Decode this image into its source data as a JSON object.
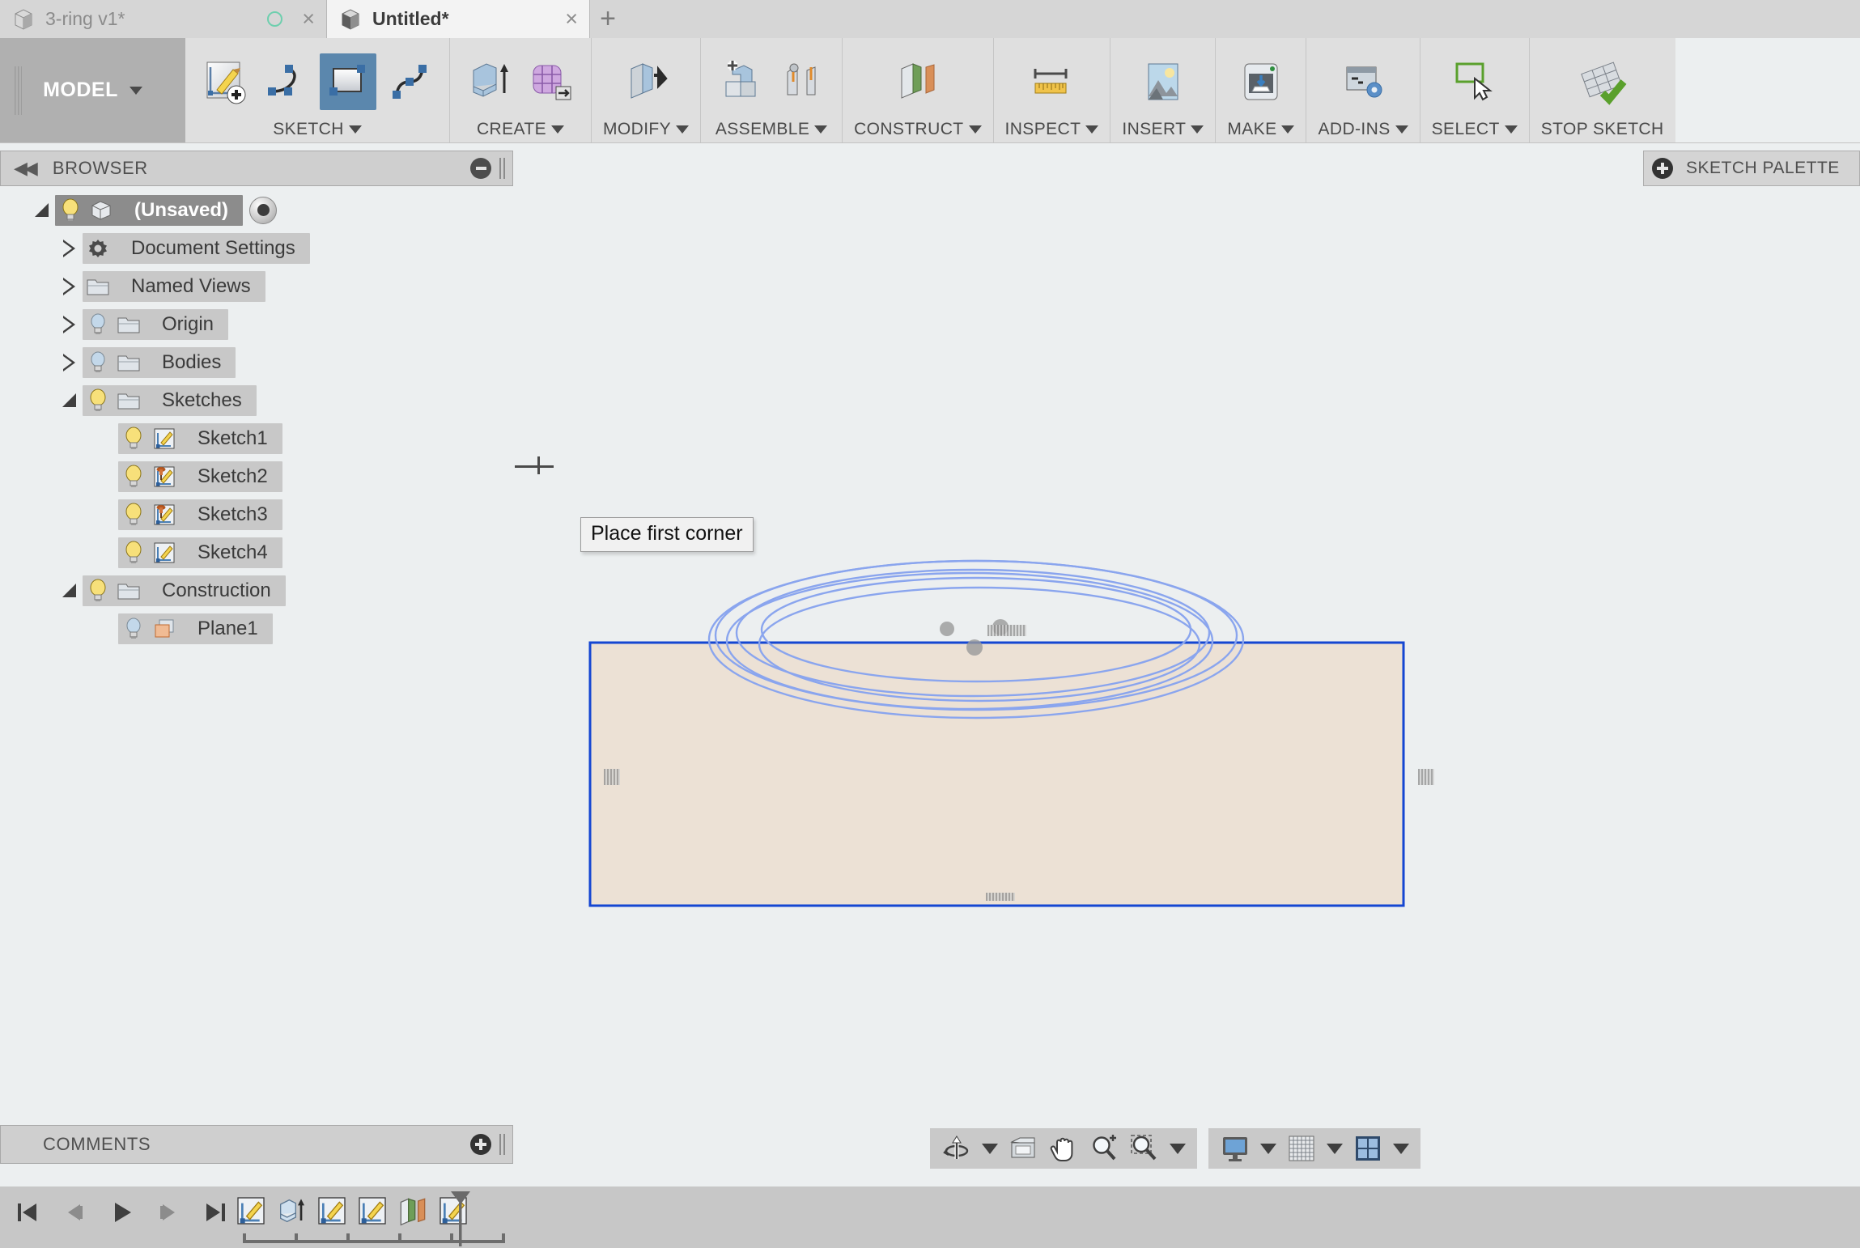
{
  "window": {
    "tabs": [
      {
        "label": "3-ring v1*",
        "active": false,
        "icon": "cube-icon",
        "has_status_circle": true,
        "close": "×"
      },
      {
        "label": "Untitled*",
        "active": true,
        "icon": "cube-icon",
        "has_status_circle": false,
        "close": "×"
      }
    ],
    "new_tab_label": "+"
  },
  "ribbon": {
    "workspace": {
      "label": "MODEL",
      "caret": "▼"
    },
    "groups": [
      {
        "name": "sketch",
        "label": "SKETCH",
        "caret": "▼",
        "tools": [
          {
            "name": "create-sketch-icon",
            "selected": false
          },
          {
            "name": "line-icon",
            "selected": false
          },
          {
            "name": "rectangle-icon",
            "selected": true
          },
          {
            "name": "spline-icon",
            "selected": false
          }
        ]
      },
      {
        "name": "create",
        "label": "CREATE",
        "caret": "▼",
        "tools": [
          {
            "name": "extrude-icon",
            "selected": false
          },
          {
            "name": "form-icon",
            "selected": false
          }
        ]
      },
      {
        "name": "modify",
        "label": "MODIFY",
        "caret": "▼",
        "tools": [
          {
            "name": "press-pull-icon",
            "selected": false
          }
        ]
      },
      {
        "name": "assemble",
        "label": "ASSEMBLE",
        "caret": "▼",
        "tools": [
          {
            "name": "new-component-icon",
            "selected": false
          },
          {
            "name": "joint-icon",
            "selected": false
          }
        ]
      },
      {
        "name": "construct",
        "label": "CONSTRUCT",
        "caret": "▼",
        "tools": [
          {
            "name": "offset-plane-icon",
            "selected": false
          }
        ]
      },
      {
        "name": "inspect",
        "label": "INSPECT",
        "caret": "▼",
        "tools": [
          {
            "name": "measure-icon",
            "selected": false
          }
        ]
      },
      {
        "name": "insert",
        "label": "INSERT",
        "caret": "▼",
        "tools": [
          {
            "name": "insert-image-icon",
            "selected": false
          }
        ]
      },
      {
        "name": "make",
        "label": "MAKE",
        "caret": "▼",
        "tools": [
          {
            "name": "3d-print-icon",
            "selected": false
          }
        ]
      },
      {
        "name": "add-ins",
        "label": "ADD-INS",
        "caret": "▼",
        "tools": [
          {
            "name": "scripts-addins-icon",
            "selected": false
          }
        ]
      },
      {
        "name": "select",
        "label": "SELECT",
        "caret": "▼",
        "tools": [
          {
            "name": "select-window-icon",
            "selected": false
          }
        ]
      },
      {
        "name": "stop-sketch",
        "label": "STOP SKETCH",
        "caret": "",
        "tools": [
          {
            "name": "stop-sketch-icon",
            "selected": false
          }
        ]
      }
    ]
  },
  "browser": {
    "title": "BROWSER",
    "collapse_arrow": "◀◀",
    "collapse_button": "minus-circle-icon",
    "tree": [
      {
        "label": "(Unsaved)",
        "depth": 0,
        "expander": "down",
        "bulb": "on",
        "icon": "component-cube-icon",
        "selected": true,
        "radio": true
      },
      {
        "label": "Document Settings",
        "depth": 1,
        "expander": "right",
        "bulb": "none",
        "icon": "gear-icon",
        "selected": false,
        "radio": false
      },
      {
        "label": "Named Views",
        "depth": 1,
        "expander": "right",
        "bulb": "none",
        "icon": "folder-icon",
        "selected": false,
        "radio": false
      },
      {
        "label": "Origin",
        "depth": 1,
        "expander": "right",
        "bulb": "off",
        "icon": "folder-icon",
        "selected": false,
        "radio": false
      },
      {
        "label": "Bodies",
        "depth": 1,
        "expander": "right",
        "bulb": "off",
        "icon": "folder-icon",
        "selected": false,
        "radio": false
      },
      {
        "label": "Sketches",
        "depth": 1,
        "expander": "down",
        "bulb": "on",
        "icon": "folder-icon",
        "selected": false,
        "radio": false
      },
      {
        "label": "Sketch1",
        "depth": 2,
        "expander": "none",
        "bulb": "on",
        "icon": "sketch-icon",
        "selected": false,
        "radio": false
      },
      {
        "label": "Sketch2",
        "depth": 2,
        "expander": "none",
        "bulb": "on",
        "icon": "sketch-pinned-icon",
        "selected": false,
        "radio": false
      },
      {
        "label": "Sketch3",
        "depth": 2,
        "expander": "none",
        "bulb": "on",
        "icon": "sketch-pinned-icon",
        "selected": false,
        "radio": false
      },
      {
        "label": "Sketch4",
        "depth": 2,
        "expander": "none",
        "bulb": "on",
        "icon": "sketch-icon",
        "selected": false,
        "radio": false
      },
      {
        "label": "Construction",
        "depth": 1,
        "expander": "down",
        "bulb": "on",
        "icon": "folder-icon",
        "selected": false,
        "radio": false
      },
      {
        "label": "Plane1",
        "depth": 2,
        "expander": "none",
        "bulb": "off",
        "icon": "plane-icon",
        "selected": false,
        "radio": false
      }
    ]
  },
  "sketch_palette": {
    "label": "SKETCH PALETTE",
    "expand_button": "plus-circle-icon"
  },
  "canvas": {
    "tooltip": "Place first corner",
    "cursor": "crosshair-icon",
    "sketch_plane": {
      "name": "active-sketch-plane",
      "fill": "#ece1d5",
      "border": "#1446d2"
    },
    "geometry": {
      "name": "three-ring-ellipses",
      "color": "#8aa5ee",
      "ring_count": 6
    },
    "markers": [
      "dimension-marker-left",
      "dimension-marker-right",
      "dimension-marker-bottom",
      "dimension-marker-center"
    ]
  },
  "navbar": {
    "buttons": [
      {
        "name": "orbit-icon",
        "caret": true
      },
      {
        "name": "look-at-icon",
        "caret": false
      },
      {
        "name": "pan-icon",
        "caret": false
      },
      {
        "name": "zoom-icon",
        "caret": false
      },
      {
        "name": "fit-icon",
        "caret": true
      }
    ],
    "display_buttons": [
      {
        "name": "display-settings-icon",
        "caret": true
      },
      {
        "name": "grid-snaps-icon",
        "caret": true
      },
      {
        "name": "viewports-icon",
        "caret": true
      }
    ]
  },
  "comments": {
    "title": "COMMENTS",
    "add_button": "plus-circle-icon"
  },
  "timeline": {
    "playback": [
      {
        "name": "jump-to-beginning-icon",
        "glyph": "⏮"
      },
      {
        "name": "step-back-icon",
        "glyph": "⏴"
      },
      {
        "name": "play-icon",
        "glyph": "⏵"
      },
      {
        "name": "step-forward-icon",
        "glyph": "⏵"
      },
      {
        "name": "jump-to-end-icon",
        "glyph": "⏭"
      }
    ],
    "features": [
      {
        "name": "timeline-feature-sketch1",
        "icon": "sketch-icon"
      },
      {
        "name": "timeline-feature-extrude1",
        "icon": "extrude-icon"
      },
      {
        "name": "timeline-feature-sketch2",
        "icon": "sketch-icon"
      },
      {
        "name": "timeline-feature-sketch3",
        "icon": "sketch-icon"
      },
      {
        "name": "timeline-feature-plane1",
        "icon": "construction-plane-icon"
      },
      {
        "name": "timeline-feature-sketch4",
        "icon": "sketch-icon"
      }
    ],
    "playhead": "timeline-marker"
  },
  "colors": {
    "accent_selected": "#5b87ad",
    "sketch_line": "#8aa5ee",
    "sketch_plane_fill": "#ece1d5",
    "sketch_plane_border": "#1446d2",
    "chrome": "#dfdfdf",
    "canvas_bg": "#eceff0"
  }
}
